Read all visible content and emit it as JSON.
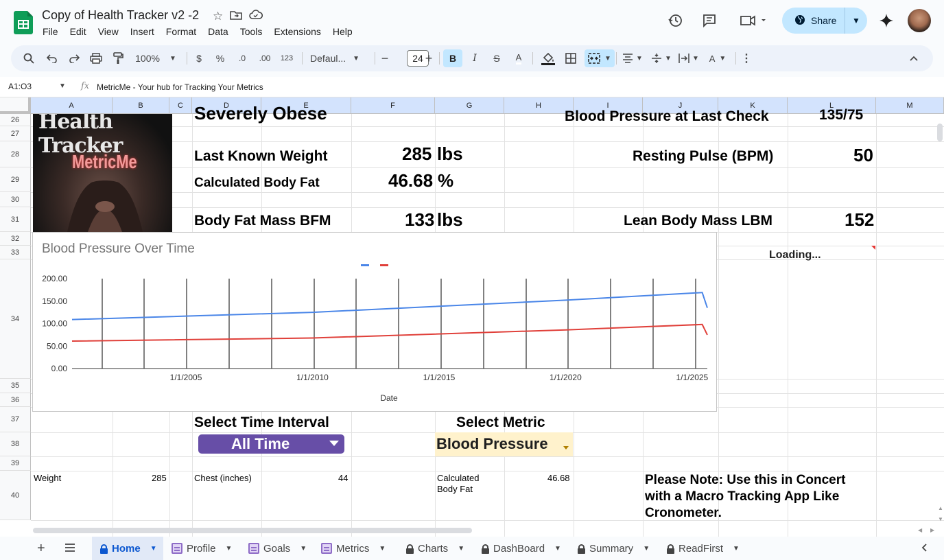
{
  "doc": {
    "title": "Copy of Health Tracker v2 -2",
    "menu": [
      "File",
      "Edit",
      "View",
      "Insert",
      "Format",
      "Data",
      "Tools",
      "Extensions",
      "Help"
    ],
    "share_label": "Share"
  },
  "toolbar": {
    "zoom": "100%",
    "currency": "$",
    "percent": "%",
    "dec_decrease": ".0",
    "dec_increase": ".00",
    "format_123": "123",
    "font": "Defaul...",
    "font_size": "24"
  },
  "formula_bar": {
    "name_box": "A1:O3",
    "fx": "fx",
    "content": "MetricMe - Your hub for Tracking Your Metrics"
  },
  "columns": [
    "A",
    "B",
    "C",
    "D",
    "E",
    "F",
    "G",
    "H",
    "I",
    "J",
    "K",
    "L",
    "M"
  ],
  "rows": [
    "26",
    "27",
    "28",
    "29",
    "30",
    "31",
    "32",
    "33",
    "34",
    "35",
    "36",
    "37",
    "38",
    "39",
    "40"
  ],
  "image": {
    "title_text": "Health Tracker",
    "brand_text": "MetricMe"
  },
  "cells": {
    "severely_obese": "Severely Obese",
    "bp_last_check_label": "Blood Pressure at Last Check",
    "bp_last_check_value": "135/75",
    "last_weight_label": "Last Known Weight",
    "last_weight_value": "285",
    "last_weight_unit": "lbs",
    "resting_pulse_label": "Resting Pulse (BPM)",
    "resting_pulse_value": "50",
    "body_fat_label": "Calculated Body Fat",
    "body_fat_value": "46.68",
    "body_fat_unit": "%",
    "bfm_label": "Body Fat Mass  BFM",
    "bfm_value": "133",
    "bfm_unit": "lbs",
    "lbm_label": "Lean Body Mass LBM",
    "lbm_value": "152",
    "loading": "Loading...",
    "select_interval_label": "Select Time Interval",
    "interval_value": "All Time",
    "select_metric_label": "Select Metric",
    "metric_value": "Blood Pressure",
    "weight_label": "Weight",
    "weight_value": "285",
    "chest_label": "Chest (inches)",
    "chest_value": "44",
    "calc_body_fat_line1": "Calculated",
    "calc_body_fat_line2": "Body Fat",
    "calc_body_fat_value": "46.68",
    "note_line1": "Please Note: Use this in Concert",
    "note_line2": "with a Macro Tracking App Like",
    "note_line3": "Cronometer."
  },
  "chart_data": {
    "type": "line",
    "title": "Blood Pressure Over Time",
    "xlabel": "Date",
    "ylabel": "",
    "x_ticks": [
      "1/1/2005",
      "1/1/2010",
      "1/1/2015",
      "1/1/2020",
      "1/1/2025"
    ],
    "y_ticks": [
      "0.00",
      "50.00",
      "100.00",
      "150.00",
      "200.00"
    ],
    "ylim": [
      0,
      200
    ],
    "xlim": [
      2000.5,
      2025.6
    ],
    "legend": "top-center",
    "series": [
      {
        "color": "#4a86e8",
        "x": [
          2000.5,
          2010,
          2020,
          2025.4,
          2025.6
        ],
        "values": [
          109,
          125,
          152,
          169,
          135
        ]
      },
      {
        "color": "#e0403a",
        "x": [
          2000.5,
          2010,
          2020,
          2025.4,
          2025.6
        ],
        "values": [
          61,
          68,
          86,
          98,
          75
        ]
      }
    ]
  },
  "sheets": [
    {
      "label": "Home",
      "locked": true,
      "active": true
    },
    {
      "label": "Profile",
      "locked": false
    },
    {
      "label": "Goals",
      "locked": false
    },
    {
      "label": "Metrics",
      "locked": false
    },
    {
      "label": "Charts",
      "locked": true
    },
    {
      "label": "DashBoard",
      "locked": true
    },
    {
      "label": "Summary",
      "locked": true
    },
    {
      "label": "ReadFirst",
      "locked": true
    }
  ],
  "colors": {
    "accent": "#0b57d0",
    "share_bg": "#c2e7ff",
    "dropdown_purple": "#674ea7",
    "metric_bg": "#fff2cc"
  }
}
